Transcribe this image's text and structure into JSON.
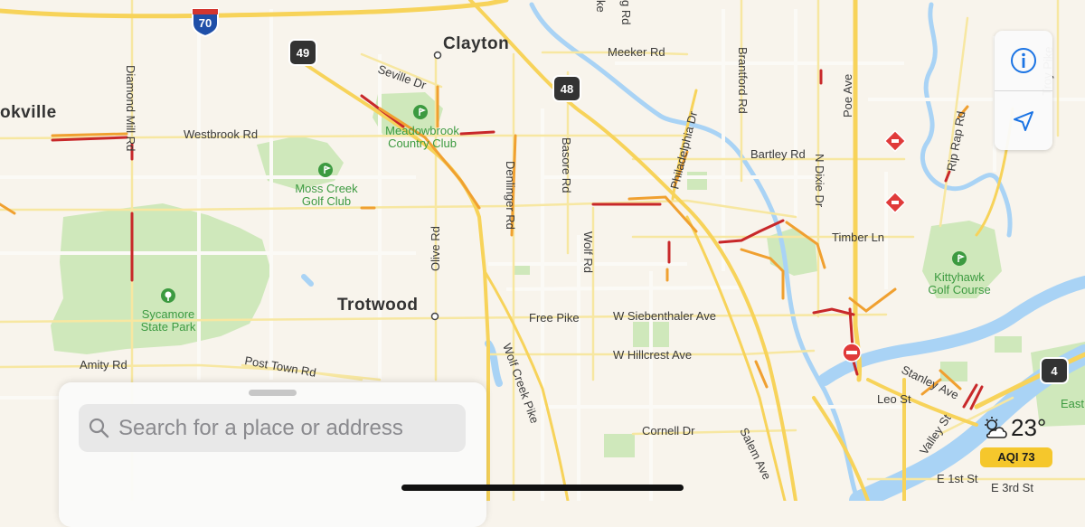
{
  "map": {
    "cities": {
      "clayton": "Clayton",
      "trotwood": "Trotwood",
      "brookville": "okville"
    },
    "parks": {
      "meadowbrook": [
        "Meadowbrook",
        "Country Club"
      ],
      "moss_creek": [
        "Moss Creek",
        "Golf Club"
      ],
      "sycamore": [
        "Sycamore",
        "State Park"
      ],
      "kittyhawk": [
        "Kittyhawk",
        "Golf Course"
      ],
      "east": "East"
    },
    "roads": {
      "meeker": "Meeker Rd",
      "seville": "Seville Dr",
      "westbrook": "Westbrook Rd",
      "bartley": "Bartley Rd",
      "diamond_mill": "Diamond Mill Rd",
      "brantford": "Brantford Rd",
      "n_dixie": "N Dixie Dr",
      "poe": "Poe Ave",
      "rip_rap": "Rip Rap Rd",
      "troy": "Troy Pike",
      "philadelphia": "Philadelphia Dr",
      "denlinger": "Denlinger Rd",
      "basore": "Basore Rd",
      "olive": "Olive Rd",
      "wolf": "Wolf Rd",
      "timber": "Timber Ln",
      "free_pike": "Free Pike",
      "siebenthaler": "W Siebenthaler Ave",
      "hillcrest": "W Hillcrest Ave",
      "amity": "Amity Rd",
      "post_town": "Post Town Rd",
      "wolf_creek": "Wolf Creek Pike",
      "cornell": "Cornell Dr",
      "salem": "Salem Ave",
      "stanley": "Stanley Ave",
      "leo": "Leo St",
      "valley": "Valley St",
      "e_first": "E 1st St",
      "e_third": "E 3rd St",
      "top_edge_1": "ke",
      "top_edge_2": "g Rd"
    },
    "shields": {
      "i70": "70",
      "r49": "49",
      "r48": "48",
      "r4": "4"
    }
  },
  "controls": {
    "info_icon": "info-icon",
    "location_icon": "location-arrow-icon"
  },
  "weather": {
    "temperature": "23°",
    "aqi": "AQI 73",
    "icon": "partly-cloudy-icon"
  },
  "search": {
    "placeholder": "Search for a place or address",
    "value": ""
  },
  "colors": {
    "land": "#f8f4ec",
    "park": "#cfe8bb",
    "water": "#a9d3f5",
    "major_road": "#f7d35a",
    "traffic_slow": "#f0a030",
    "traffic_heavy": "#c8282a",
    "accent": "#1b74e4",
    "aqi_badge": "#f5c72c"
  }
}
